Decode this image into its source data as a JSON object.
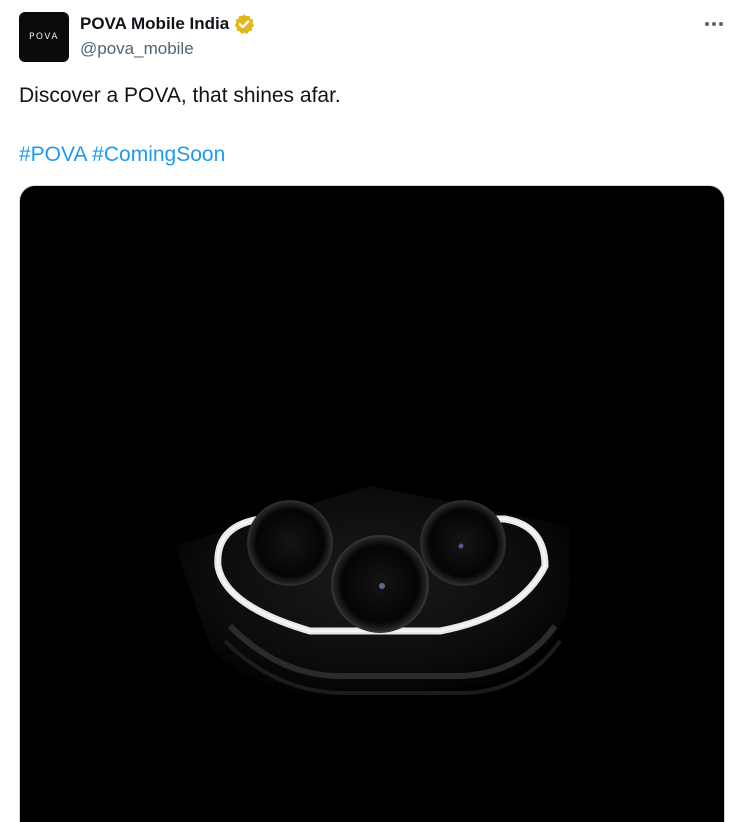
{
  "tweet": {
    "author": {
      "display_name": "POVA Mobile India",
      "handle": "@pova_mobile",
      "avatar_text": "POVA",
      "verified_color": "#e2b719"
    },
    "text": "Discover a POVA, that shines afar.",
    "hashtags": [
      "#POVA",
      "#ComingSoon"
    ],
    "media": {
      "icon": "phone-camera-image"
    }
  },
  "colors": {
    "link": "#1d9bf0",
    "text": "#0f1419",
    "secondary": "#536471"
  }
}
